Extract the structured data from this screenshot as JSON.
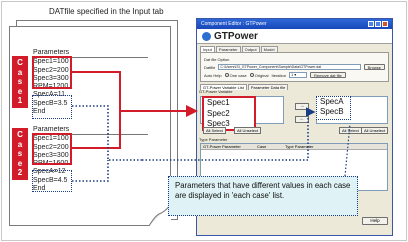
{
  "doc": {
    "title": "DATfile specified in the Input tab",
    "case1_label": [
      "C",
      "a",
      "s",
      "e",
      "1"
    ],
    "case2_label": [
      "C",
      "a",
      "s",
      "e",
      "2"
    ],
    "block1": [
      "Parameters",
      "Spec1=100",
      "Spec2=200",
      "Spec3=300",
      "RPM=1200",
      "SpecA=11",
      "SpecB=3.5",
      "End"
    ],
    "block2": [
      "Parameters",
      "Spec1=100",
      "Spec2=200",
      "Spec3=300",
      "RPM=1600",
      "SpecA=12",
      "SpecB=4.5",
      "End"
    ]
  },
  "window": {
    "title": "Component Editor : GTPower",
    "app_name": "GTPower",
    "tabs": [
      "Input",
      "Parameter",
      "Output",
      "Model"
    ],
    "dat_option_label": "Dat file Option",
    "datfile_label": "Datfile",
    "datfile_value": "C:\\Users\\ISI_GTPower_Component\\Sample\\Data\\GTPower.dat",
    "browse_label": "Browse",
    "auto_help_label": "Auto Help",
    "radio_one_case": "One case",
    "radio_original": "Original",
    "iteration_label": "Iteration",
    "iteration_value": "1",
    "iteration_to": "0",
    "remove_datfile_label": "Remove dat file",
    "sub_tabs": [
      "GT-Power Variable List",
      "Parameter Data file"
    ],
    "gt_power_variable_label": "GT-Power Variable",
    "left_list": [
      "Spec1",
      "Spec2",
      "Spec3"
    ],
    "right_list": [
      "SpecA",
      "SpecB"
    ],
    "arrow_right": "→",
    "arrow_left": "←",
    "all_select_left": "All Select",
    "all_unselect_left": "All Unselect",
    "all_select_right": "All Select",
    "all_unselect_right": "All Unselect",
    "type_parameter_label": "Type Parameter",
    "type_columns": [
      "GT-Power Parameter",
      "Case",
      "Type Parameter"
    ],
    "help_label": "Help"
  },
  "callout": {
    "text": "Parameters that have different values in each case are displayed in 'each case' list."
  },
  "colors": {
    "highlight_red": "#d21c2a",
    "dotted_blue": "#1a3c86",
    "callout_bg": "#dff2f5"
  }
}
